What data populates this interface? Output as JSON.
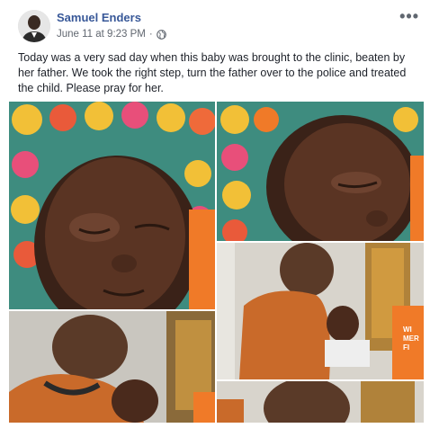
{
  "post": {
    "author_name": "Samuel Enders",
    "timestamp": "June 11 at 9:23 PM",
    "separator": "·",
    "audience_icon": "globe-icon",
    "more_label": "•••",
    "text": "Today was a very sad day when this baby was brought to the clinic, beaten by her father. We took the right step, turn the father over to the police and treated the child. Please pray for her."
  },
  "photos": [
    {
      "subject": "baby-face-closeup-left"
    },
    {
      "subject": "baby-face-closeup-right"
    },
    {
      "subject": "man-in-orange-shirt-with-baby"
    },
    {
      "subject": "man-holding-baby-in-clinic"
    },
    {
      "subject": "man-head-bottom"
    }
  ],
  "photo_overlay_text": {
    "shirt_letters": "WI\nMER\nFI"
  },
  "colors": {
    "author_link": "#385898",
    "meta_text": "#616770",
    "body_text": "#1d2129",
    "shirt_orange": "#c96a2a",
    "wrapper_yellow": "#f2c037",
    "wrapper_teal": "#3c9b8c"
  }
}
